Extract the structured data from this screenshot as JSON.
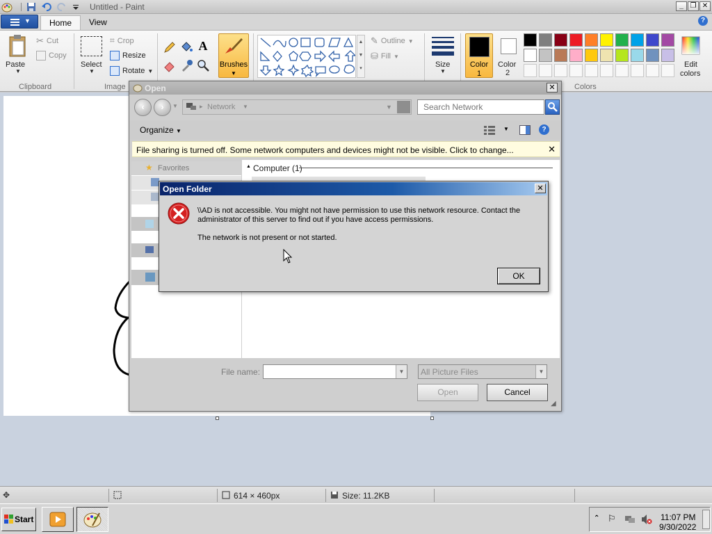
{
  "window": {
    "title": "Untitled - Paint"
  },
  "ribbon": {
    "tabs": [
      {
        "label": "Home"
      },
      {
        "label": "View"
      }
    ],
    "clipboard": {
      "paste": "Paste",
      "cut": "Cut",
      "copy": "Copy",
      "group": "Clipboard"
    },
    "image": {
      "select": "Select",
      "crop": "Crop",
      "resize": "Resize",
      "rotate": "Rotate",
      "group": "Image"
    },
    "tools": {
      "brushes": "Brushes"
    },
    "shapes": {
      "outline": "Outline",
      "fill": "Fill"
    },
    "size": "Size",
    "color1": {
      "line1": "Color",
      "line2": "1"
    },
    "color2": {
      "line1": "Color",
      "line2": "2"
    },
    "edit_colors": {
      "line1": "Edit",
      "line2": "colors"
    },
    "colors_group": "Colors",
    "palette": [
      "#000000",
      "#7f7f7f",
      "#880015",
      "#ed1c24",
      "#ff7f27",
      "#fff200",
      "#22b14c",
      "#00a2e8",
      "#3f48cc",
      "#a349a4",
      "#ffffff",
      "#c3c3c3",
      "#b97a57",
      "#ffaec9",
      "#ffc90e",
      "#efe4b0",
      "#b5e61d",
      "#99d9ea",
      "#7092be",
      "#c8bfe7"
    ]
  },
  "open_dialog": {
    "title": "Open",
    "address": "Network",
    "search_placeholder": "Search Network",
    "organize": "Organize",
    "infobar": "File sharing is turned off. Some network computers and devices might not be visible. Click to change...",
    "favorites": "Favorites",
    "group_header": "Computer (1)",
    "file_name_label": "File name:",
    "file_type": "All Picture Files",
    "open_btn": "Open",
    "cancel_btn": "Cancel"
  },
  "error_dialog": {
    "title": "Open Folder",
    "message1": "\\\\AD is not accessible. You might not have permission to use this network resource. Contact the administrator of this server to find out if you have access permissions.",
    "message2": "The network is not present or not started.",
    "ok": "OK"
  },
  "statusbar": {
    "dimensions": "614 × 460px",
    "size": "Size: 11.2KB"
  },
  "taskbar": {
    "start": "Start",
    "time": "11:07 PM",
    "date": "9/30/2022"
  }
}
